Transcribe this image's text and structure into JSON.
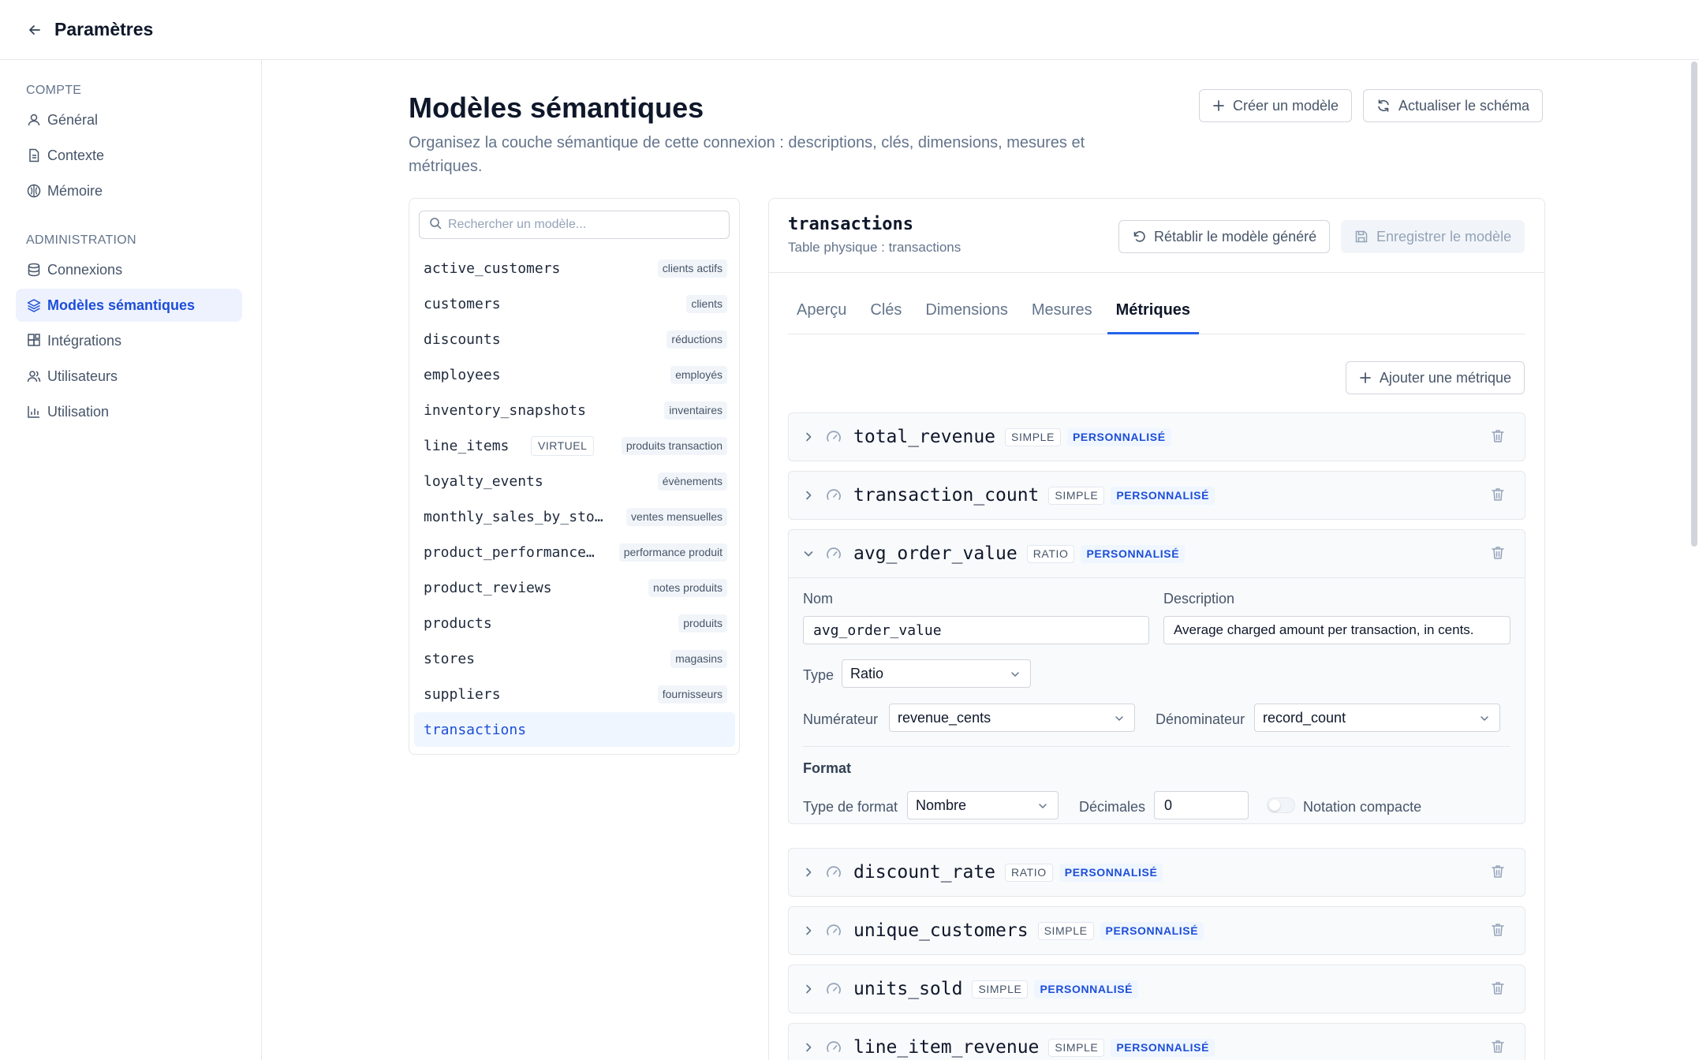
{
  "topbar": {
    "title": "Paramètres",
    "back_icon": "arrow-left-icon"
  },
  "sidebar": {
    "section_account": "COMPTE",
    "account_items": [
      {
        "label": "Général",
        "icon": "user-icon"
      },
      {
        "label": "Contexte",
        "icon": "document-icon"
      },
      {
        "label": "Mémoire",
        "icon": "brain-icon"
      }
    ],
    "section_admin": "ADMINISTRATION",
    "admin_items": [
      {
        "label": "Connexions",
        "icon": "database-icon"
      },
      {
        "label": "Modèles sémantiques",
        "icon": "layers-icon",
        "active": true
      },
      {
        "label": "Intégrations",
        "icon": "puzzle-icon"
      },
      {
        "label": "Utilisateurs",
        "icon": "users-icon"
      },
      {
        "label": "Utilisation",
        "icon": "bar-chart-icon"
      }
    ]
  },
  "main": {
    "title": "Modèles sémantiques",
    "description": "Organisez la couche sémantique de cette connexion : descriptions, clés, dimensions, mesures et métriques.",
    "create_label": "Créer un modèle",
    "refresh_label": "Actualiser le schéma"
  },
  "model_list": {
    "search_placeholder": "Rechercher un modèle...",
    "models": [
      {
        "name": "active_customers",
        "tag": "clients actifs"
      },
      {
        "name": "customers",
        "tag": "clients"
      },
      {
        "name": "discounts",
        "tag": "réductions"
      },
      {
        "name": "employees",
        "tag": "employés"
      },
      {
        "name": "inventory_snapshots",
        "tag": "inventaires"
      },
      {
        "name": "line_items",
        "tag": "produits transaction",
        "badge": "VIRTUEL"
      },
      {
        "name": "loyalty_events",
        "tag": "évènements"
      },
      {
        "name": "monthly_sales_by_sto…",
        "tag": "ventes mensuelles"
      },
      {
        "name": "product_performance…",
        "tag": "performance produit"
      },
      {
        "name": "product_reviews",
        "tag": "notes produits"
      },
      {
        "name": "products",
        "tag": "produits"
      },
      {
        "name": "stores",
        "tag": "magasins"
      },
      {
        "name": "suppliers",
        "tag": "fournisseurs"
      },
      {
        "name": "transactions",
        "tag": "",
        "active": true
      }
    ]
  },
  "detail": {
    "name": "transactions",
    "subtitle": "Table physique : transactions",
    "reset_label": "Rétablir le modèle généré",
    "save_label": "Enregistrer le modèle",
    "tabs": [
      "Aperçu",
      "Clés",
      "Dimensions",
      "Mesures",
      "Métriques"
    ],
    "active_tab": "Métriques",
    "add_metric_label": "Ajouter une métrique",
    "metrics": [
      {
        "name": "total_revenue",
        "kind": "SIMPLE",
        "status": "PERSONNALISÉ"
      },
      {
        "name": "transaction_count",
        "kind": "SIMPLE",
        "status": "PERSONNALISÉ"
      },
      {
        "name": "avg_order_value",
        "kind": "RATIO",
        "status": "PERSONNALISÉ",
        "expanded": true
      },
      {
        "name": "discount_rate",
        "kind": "RATIO",
        "status": "PERSONNALISÉ"
      },
      {
        "name": "unique_customers",
        "kind": "SIMPLE",
        "status": "PERSONNALISÉ"
      },
      {
        "name": "units_sold",
        "kind": "SIMPLE",
        "status": "PERSONNALISÉ"
      },
      {
        "name": "line_item_revenue",
        "kind": "SIMPLE",
        "status": "PERSONNALISÉ"
      }
    ],
    "expanded_form": {
      "name_label": "Nom",
      "name_value": "avg_order_value",
      "description_label": "Description",
      "description_value": "Average charged amount per transaction, in cents.",
      "type_label": "Type",
      "type_value": "Ratio",
      "numerator_label": "Numérateur",
      "numerator_value": "revenue_cents",
      "denominator_label": "Dénominateur",
      "denominator_value": "record_count",
      "format_title": "Format",
      "format_type_label": "Type de format",
      "format_type_value": "Nombre",
      "decimals_label": "Décimales",
      "decimals_value": "0",
      "compact_label": "Notation compacte",
      "compact_on": false
    }
  },
  "colors": {
    "accent": "#2563eb",
    "active_bg": "#eef2ff",
    "muted_text": "#64748b",
    "border": "#e5e7eb"
  }
}
